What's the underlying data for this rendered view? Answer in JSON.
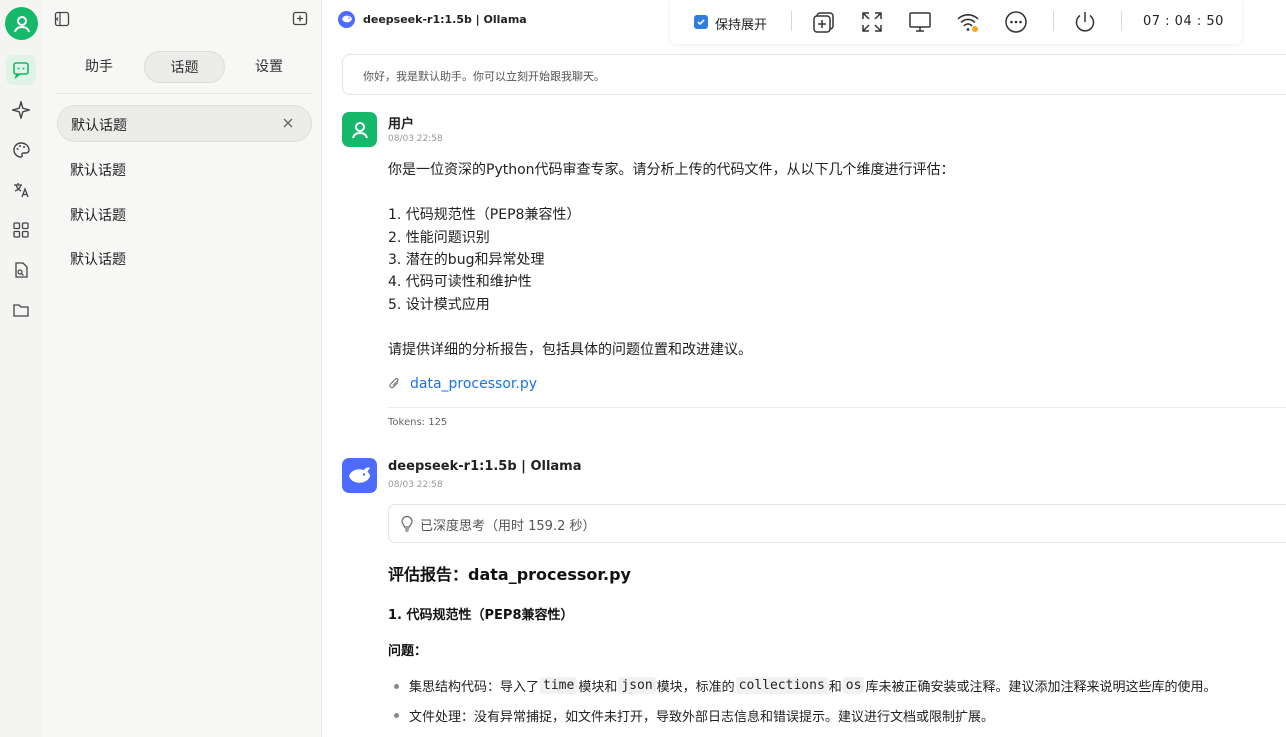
{
  "header": {
    "model_title": "deepseek-r1:1.5b | Ollama"
  },
  "systray": {
    "keep_expanded_label": "保持展开",
    "clock": "07 : 04 : 50"
  },
  "panel": {
    "tabs": [
      {
        "label": "助手"
      },
      {
        "label": "话题"
      },
      {
        "label": "设置"
      }
    ],
    "selected_topic": "默认话题",
    "topics": [
      "默认话题",
      "默认话题",
      "默认话题"
    ]
  },
  "chat": {
    "greeting": "你好，我是默认助手。你可以立刻开始跟我聊天。",
    "user_message": {
      "name": "用户",
      "time": "08/03 22:58",
      "lines": [
        "你是一位资深的Python代码审查专家。请分析上传的代码文件，从以下几个维度进行评估：",
        "1. 代码规范性（PEP8兼容性）",
        "2. 性能问题识别",
        "3. 潜在的bug和异常处理",
        "4. 代码可读性和维护性",
        "5. 设计模式应用",
        "请提供详细的分析报告，包括具体的问题位置和改进建议。"
      ],
      "attachment": "data_processor.py",
      "tokens": "Tokens: 125"
    },
    "assistant_message": {
      "name": "deepseek-r1:1.5b | Ollama",
      "time": "08/03 22:58",
      "thinking": "已深度思考（用时 159.2 秒）",
      "report_title": "评估报告：data_processor.py",
      "section_title": "1. 代码规范性（PEP8兼容性）",
      "problem_label": "问题：",
      "bullet1": {
        "p1": "集思结构代码：导入了",
        "c1": "time",
        "p2": "模块和",
        "c2": "json",
        "p3": "模块，标准的",
        "c3": "collections",
        "p4": "和",
        "c4": "os",
        "p5": "库未被正确安装或注释。建议添加注释来说明这些库的使用。"
      },
      "bullet2": "文件处理：没有异常捕捉，如文件未打开，导致外部日志信息和错误提示。建议进行文档或限制扩展。"
    }
  },
  "colors": {
    "brand_green": "#16b86a",
    "deepseek_blue": "#4d6bfe",
    "link_blue": "#1a73e8"
  }
}
